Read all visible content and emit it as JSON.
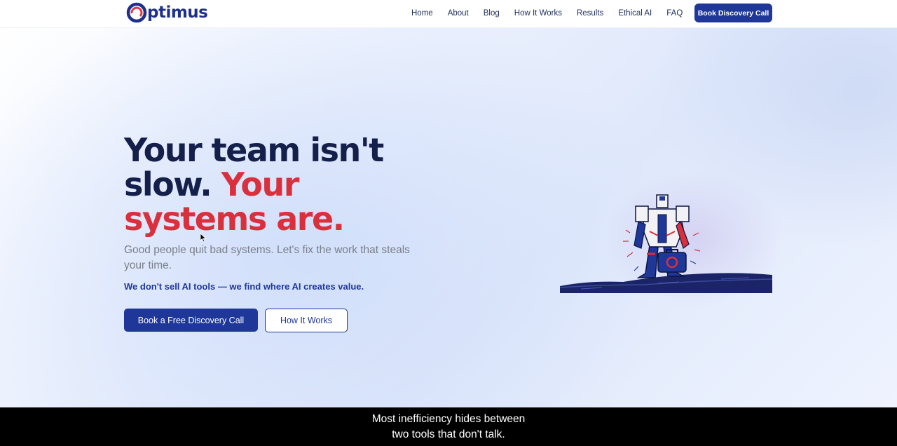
{
  "brand": {
    "logo_text": "ptimus",
    "logo_letter": "O"
  },
  "nav": {
    "links": [
      "Home",
      "About",
      "Blog",
      "How It Works",
      "Results",
      "Ethical AI",
      "FAQ"
    ],
    "cta_label": "Book Discovery Call"
  },
  "hero": {
    "headline_part1": "Your team isn't slow.",
    "headline_part2": "Your systems are.",
    "subhead": "Good people quit bad systems. Let's fix the work that steals your time.",
    "value_line": "We don't sell AI tools — we find where AI creates value.",
    "primary_button": "Book a Free Discovery Call",
    "secondary_button": "How It Works"
  },
  "caption": {
    "line1": "Most inefficiency hides between",
    "line2": "two tools that don't talk."
  },
  "colors": {
    "brand_navy": "#1e3799",
    "headline_dark": "#141f4a",
    "accent_red": "#da2f3c"
  },
  "icons": {
    "robot": "robot-with-briefcase-illustration",
    "cursor": "mouse-pointer-icon"
  }
}
